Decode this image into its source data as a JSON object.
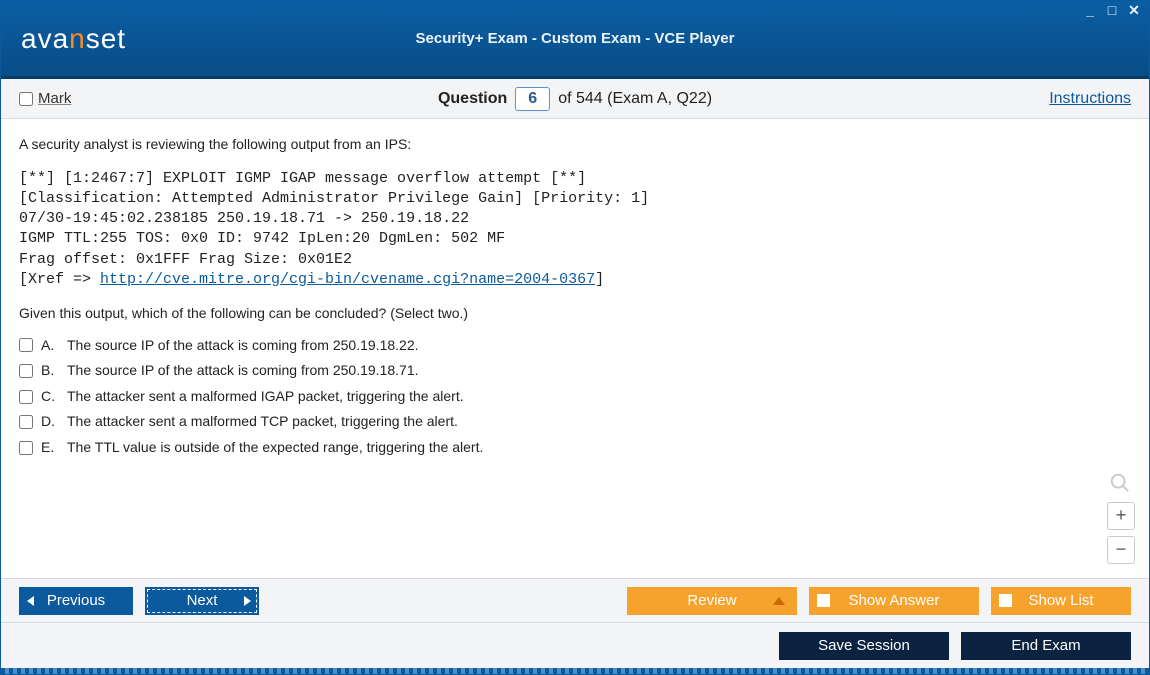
{
  "window": {
    "title": "Security+ Exam - Custom Exam - VCE Player",
    "logo_prefix": "ava",
    "logo_n": "n",
    "logo_suffix": "set"
  },
  "infobar": {
    "mark_label": "Mark",
    "question_word": "Question",
    "current": "6",
    "of_text": "of 544 (Exam A, Q22)",
    "instructions": "Instructions"
  },
  "question": {
    "intro": "A security analyst is reviewing the following output from an IPS:",
    "cve_link_text": "http://cve.mitre.org/cgi-bin/cvename.cgi?name=2004-0367",
    "ips_output": {
      "line1": "[**] [1:2467:7] EXPLOIT IGMP IGAP message overflow attempt [**]",
      "line2": "[Classification: Attempted Administrator Privilege Gain] [Priority: 1]",
      "line3": "07/30-19:45:02.238185 250.19.18.71 -> 250.19.18.22",
      "line4": "IGMP TTL:255 TOS: 0x0 ID: 9742 IpLen:20 DgmLen: 502 MF",
      "line5": "Frag offset: 0x1FFF Frag Size: 0x01E2",
      "xref_prefix": "[Xref => ",
      "xref_suffix": "]"
    },
    "sub": "Given this output, which of the following can be concluded? (Select two.)",
    "options": [
      {
        "letter": "A.",
        "text": "The source IP of the attack is coming from 250.19.18.22."
      },
      {
        "letter": "B.",
        "text": "The source IP of the attack is coming from 250.19.18.71."
      },
      {
        "letter": "C.",
        "text": "The attacker sent a malformed IGAP packet, triggering the alert."
      },
      {
        "letter": "D.",
        "text": "The attacker sent a malformed TCP packet, triggering the alert."
      },
      {
        "letter": "E.",
        "text": "The TTL value is outside of the expected range, triggering the alert."
      }
    ]
  },
  "nav": {
    "previous": "Previous",
    "next": "Next",
    "review": "Review",
    "show_answer": "Show Answer",
    "show_list": "Show List",
    "save_session": "Save Session",
    "end_exam": "End Exam"
  }
}
